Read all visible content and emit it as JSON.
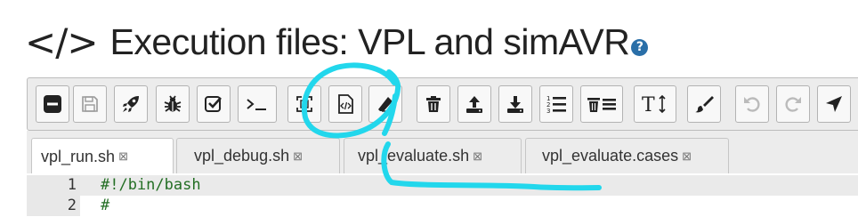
{
  "header": {
    "code_glyph": "</>",
    "title": "Execution files: VPL and simAVR",
    "help_glyph": "?"
  },
  "toolbar": {
    "buttons": [
      {
        "name": "menu-toggle-button",
        "icon": "minus-square-icon"
      },
      {
        "name": "save-button",
        "icon": "floppy-icon"
      },
      {
        "name": "run-button",
        "icon": "rocket-icon"
      },
      {
        "name": "debug-button",
        "icon": "bug-icon"
      },
      {
        "name": "evaluate-button",
        "icon": "check-square-icon"
      },
      {
        "name": "console-button",
        "icon": "terminal-icon"
      },
      {
        "name": "fullscreen-button",
        "icon": "expand-icon"
      },
      {
        "name": "file-code-button",
        "icon": "file-code-icon"
      },
      {
        "name": "rename-button",
        "icon": "eraser-icon"
      },
      {
        "name": "delete-button",
        "icon": "trash-icon"
      },
      {
        "name": "upload-button",
        "icon": "upload-icon"
      },
      {
        "name": "download-button",
        "icon": "download-icon"
      },
      {
        "name": "line-numbers-button",
        "icon": "list-ol-icon"
      },
      {
        "name": "delete-all-button",
        "icon": "trash-list-icon"
      },
      {
        "name": "font-size-button",
        "icon": "text-height-icon"
      },
      {
        "name": "theme-button",
        "icon": "paintbrush-icon"
      },
      {
        "name": "undo-button",
        "icon": "undo-icon"
      },
      {
        "name": "redo-button",
        "icon": "redo-icon"
      },
      {
        "name": "navigate-button",
        "icon": "location-arrow-icon"
      }
    ],
    "text_height_label": "T"
  },
  "tabs": [
    {
      "label": "vpl_run.sh",
      "active": true
    },
    {
      "label": "vpl_debug.sh",
      "active": false
    },
    {
      "label": "vpl_evaluate.sh",
      "active": false
    },
    {
      "label": "vpl_evaluate.cases",
      "active": false
    }
  ],
  "tab_close_glyph": "⊠",
  "editor": {
    "lines": [
      {
        "number": "1",
        "text": "#!/bin/bash"
      },
      {
        "number": "2",
        "text": "#"
      }
    ]
  },
  "colors": {
    "annotation": "#22d7ec",
    "help": "#2a6fa8",
    "comment": "#236e24"
  }
}
